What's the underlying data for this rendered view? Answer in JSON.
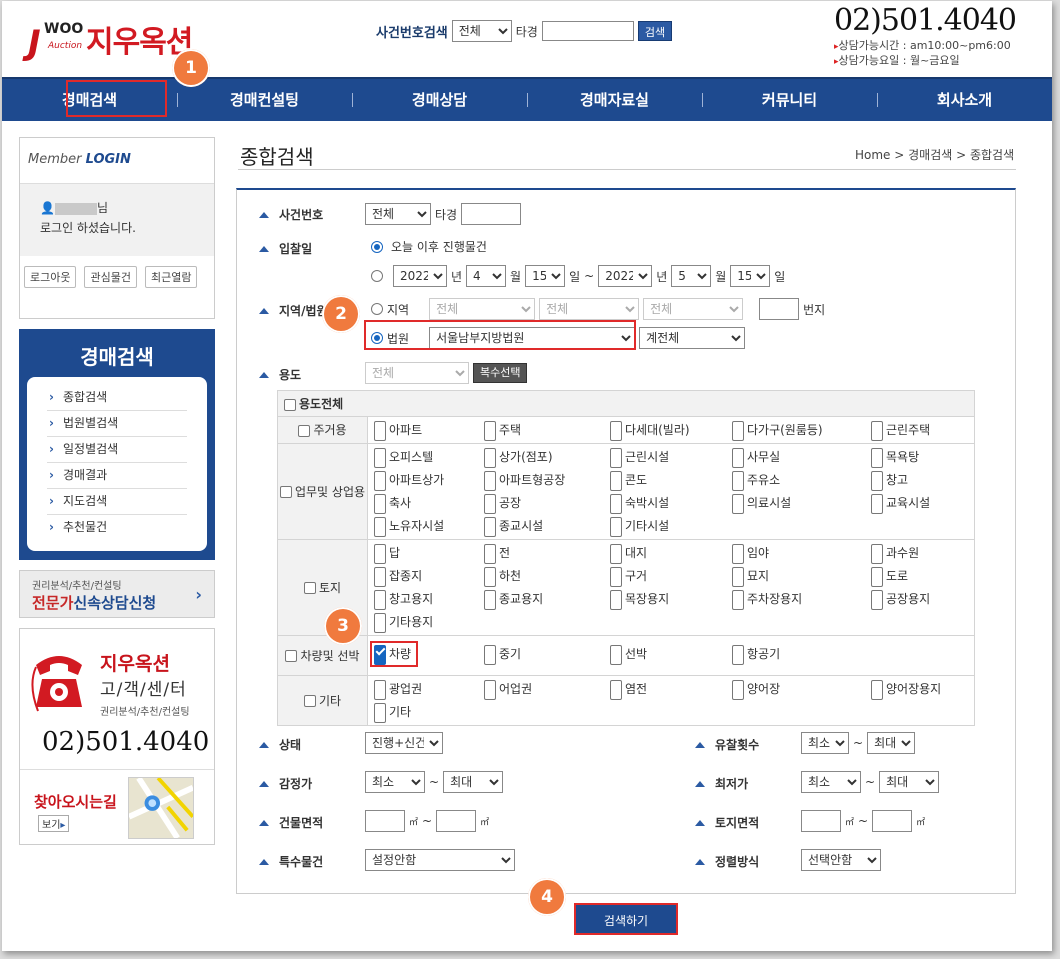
{
  "header": {
    "logo": {
      "j": "J",
      "woo": "WOO",
      "auction": "Auction",
      "brand": "지우옥션"
    },
    "top_search": {
      "label": "사건번호검색",
      "select": "전체",
      "court_label": "타경",
      "button": "검색"
    },
    "phone": "02)501.4040",
    "hours": [
      "상담가능시간 : am10:00~pm6:00",
      "상담가능요일 : 월~금요일"
    ]
  },
  "nav": [
    "경매검색",
    "경매컨설팅",
    "경매상담",
    "경매자료실",
    "커뮤니티",
    "회사소개"
  ],
  "markers": [
    "1",
    "2",
    "3",
    "4"
  ],
  "sidebar": {
    "login_title_a": "Member",
    "login_title_b": "LOGIN",
    "user_suffix": "님",
    "logged_in": "로그인 하셨습니다.",
    "buttons": [
      "로그아웃",
      "관심물건",
      "최근열람"
    ],
    "menu_title": "경매검색",
    "menu": [
      "종합검색",
      "법원별검색",
      "일정별검색",
      "경매결과",
      "지도검색",
      "추천물건"
    ],
    "consult_small": "권리분석/추천/컨설팅",
    "consult_a": "전문가",
    "consult_b": "신속상담신청",
    "cs_name": "지우옥션",
    "cs_center": "고/객/센/터",
    "cs_sub": "권리분석/추천/컨설팅",
    "cs_phone": "02)501.4040",
    "directions": "찾아오시는길",
    "view": "보기"
  },
  "page": {
    "title": "종합검색",
    "breadcrumb": "Home > 경매검색 > 종합검색"
  },
  "form": {
    "case_label": "사건번호",
    "case_select": "전체",
    "case_court": "타경",
    "date_label": "입찰일",
    "date_opt1": "오늘 이후 진행물건",
    "date": {
      "y1": "2022",
      "m1": "4",
      "d1": "15",
      "y2": "2022",
      "m2": "5",
      "d2": "15",
      "year": "년",
      "month": "월",
      "day": "일",
      "tilde": "~"
    },
    "region_label": "지역/법원",
    "region_opt": "지역",
    "region_selects": [
      "전체",
      "전체",
      "전체"
    ],
    "bunji": "번지",
    "court_opt": "법원",
    "court_value": "서울남부지방법원",
    "court_dept": "계전체",
    "use_label": "용도",
    "use_select": "전체",
    "multi_btn": "복수선택",
    "use_all": "용도전체",
    "use_groups": [
      {
        "name": "주거용",
        "items": [
          "아파트",
          "주택",
          "다세대(빌라)",
          "다가구(원룸등)",
          "근린주택"
        ]
      },
      {
        "name": "업무및 상업용",
        "items": [
          "오피스텔",
          "상가(점포)",
          "근린시설",
          "사무실",
          "목욕탕",
          "아파트상가",
          "아파트형공장",
          "콘도",
          "주유소",
          "창고",
          "축사",
          "공장",
          "숙박시설",
          "의료시설",
          "교육시설",
          "노유자시설",
          "종교시설",
          "기타시설"
        ]
      },
      {
        "name": "토지",
        "items": [
          "답",
          "전",
          "대지",
          "임야",
          "과수원",
          "잡종지",
          "하천",
          "구거",
          "묘지",
          "도로",
          "창고용지",
          "종교용지",
          "목장용지",
          "주차장용지",
          "공장용지",
          "기타용지"
        ]
      },
      {
        "name": "차량및 선박",
        "items": [
          "차량",
          "중기",
          "선박",
          "항공기"
        ]
      },
      {
        "name": "기타",
        "items": [
          "광업권",
          "어업권",
          "염전",
          "양어장",
          "양어장용지",
          "기타"
        ]
      }
    ],
    "status_label": "상태",
    "status_value": "진행+신건",
    "fail_label": "유찰횟수",
    "min": "최소",
    "max": "최대",
    "tilde": "~",
    "appraisal_label": "감정가",
    "lowest_label": "최저가",
    "bldg_label": "건물면적",
    "land_label": "토지면적",
    "unit": "㎡",
    "special_label": "특수물건",
    "special_value": "설정안함",
    "sort_label": "정렬방식",
    "sort_value": "선택안함",
    "submit": "검색하기"
  }
}
